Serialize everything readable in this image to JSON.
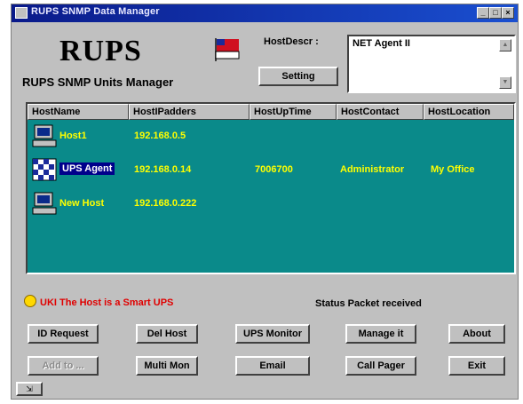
{
  "window": {
    "title": "RUPS SNMP Data Manager",
    "controls": [
      "_",
      "□",
      "×"
    ]
  },
  "header": {
    "logo": "RUPS",
    "subtitle": "RUPS SNMP Units Manager",
    "host_desc_label": "HostDescr :",
    "setting_label": "Setting",
    "host_desc_value": "NET Agent II"
  },
  "table": {
    "columns": [
      "HostName",
      "HostIPadders",
      "HostUpTime",
      "HostContact",
      "HostLocation"
    ],
    "rows": [
      {
        "name": "Host1",
        "ip": "192.168.0.5",
        "uptime": "",
        "contact": "",
        "location": "",
        "selected": false,
        "icon": "computer-icon"
      },
      {
        "name": "UPS Agent",
        "ip": "192.168.0.14",
        "uptime": "7006700",
        "contact": "Administrator",
        "location": "My Office",
        "selected": true,
        "icon": "ups-agent-icon"
      },
      {
        "name": "New Host",
        "ip": "192.168.0.222",
        "uptime": "",
        "contact": "",
        "location": "",
        "selected": false,
        "icon": "computer-icon"
      }
    ]
  },
  "status": {
    "warning": "UKI The Host is a Smart UPS",
    "message": "Status Packet received"
  },
  "buttons": {
    "row1": [
      "ID Request",
      "Del Host",
      "UPS Monitor",
      "Manage it",
      "About"
    ],
    "row2": [
      "Add to ...",
      "Multi Mon",
      "Email",
      "Call Pager",
      "Exit"
    ]
  },
  "colors": {
    "list_bg": "#0a8a8a",
    "cell_text": "#ffff00",
    "titlebar": "#0a1a8a",
    "warning_text": "#e00000"
  }
}
